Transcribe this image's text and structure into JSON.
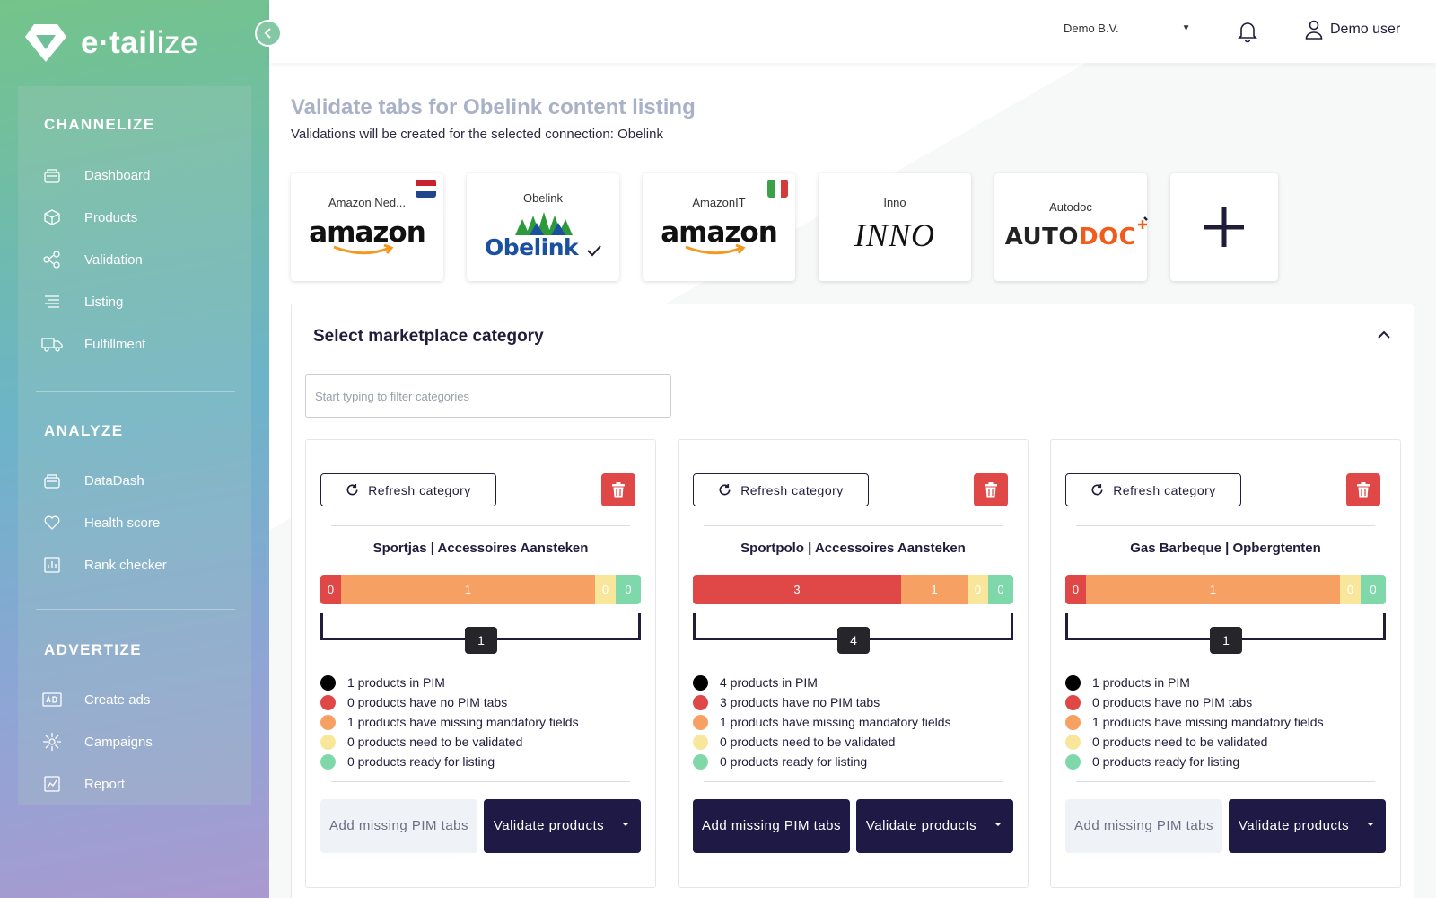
{
  "brand": {
    "name_bold": "e·tail",
    "name_thin": "ize"
  },
  "sidebar": {
    "sections": [
      {
        "title": "CHANNELIZE",
        "items": [
          "Dashboard",
          "Products",
          "Validation",
          "Listing",
          "Fulfillment"
        ]
      },
      {
        "title": "ANALYZE",
        "items": [
          "DataDash",
          "Health score",
          "Rank checker"
        ]
      },
      {
        "title": "ADVERTIZE",
        "items": [
          "Create ads",
          "Campaigns",
          "Report"
        ]
      }
    ]
  },
  "topbar": {
    "organization": "Demo B.V.",
    "user": "Demo user"
  },
  "page": {
    "title": "Validate tabs for Obelink content listing",
    "subtitle": "Validations will be created for the selected connection: Obelink"
  },
  "connections": [
    {
      "name": "Amazon Ned...",
      "logo": "amazon",
      "flag": "netherlands-flag"
    },
    {
      "name": "Obelink",
      "logo": "Obelink",
      "flag": ""
    },
    {
      "name": "AmazonIT",
      "logo": "amazon",
      "flag": "italy-flag"
    },
    {
      "name": "Inno",
      "logo": "INNO",
      "flag": ""
    },
    {
      "name": "Autodoc",
      "logo_a": "AUTO",
      "logo_b": "DOC",
      "flag": ""
    },
    {
      "name": "+",
      "logo": "add-icon"
    }
  ],
  "category_panel": {
    "title": "Select marketplace category",
    "filter_placeholder": "Start typing to filter categories",
    "refresh_label": "Refresh category",
    "add_label": "Add missing PIM tabs",
    "validate_label": "Validate products",
    "cards": [
      {
        "title": "Sportjas | Accessoires Aansteken",
        "segments": {
          "red": "0",
          "orange": "1",
          "yellow": "0",
          "green": "0"
        },
        "total": "1",
        "legend": [
          "1 products in PIM",
          "0 products have no PIM tabs",
          "1 products have missing mandatory fields",
          "0 products need to be validated",
          "0 products ready for listing"
        ],
        "add_enabled": false
      },
      {
        "title": "Sportpolo | Accessoires Aansteken",
        "segments": {
          "red": "3",
          "orange": "1",
          "yellow": "0",
          "green": "0"
        },
        "total": "4",
        "legend": [
          "4 products in PIM",
          "3 products have no PIM tabs",
          "1 products have missing mandatory fields",
          "0 products need to be validated",
          "0 products ready for listing"
        ],
        "add_enabled": true
      },
      {
        "title": "Gas Barbeque | Opbergtenten",
        "segments": {
          "red": "0",
          "orange": "1",
          "yellow": "0",
          "green": "0"
        },
        "total": "1",
        "legend": [
          "1 products in PIM",
          "0 products have no PIM tabs",
          "1 products have missing mandatory fields",
          "0 products need to be validated",
          "0 products ready for listing"
        ],
        "add_enabled": false
      }
    ]
  },
  "colors": {
    "red": "#e04848",
    "orange": "#f7a063",
    "yellow": "#f8e79a",
    "green": "#7fd8a9",
    "navy": "#1f1a45"
  }
}
